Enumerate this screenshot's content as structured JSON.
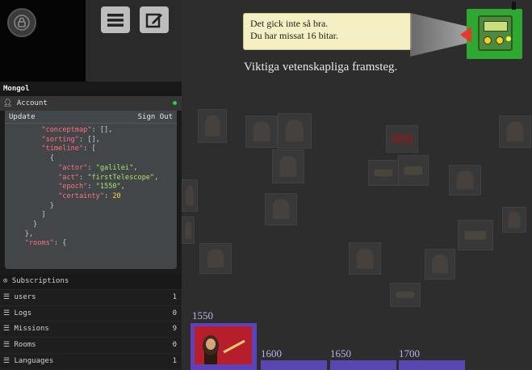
{
  "app": {
    "title": "Mongol"
  },
  "account": {
    "label": "Account",
    "status_color": "#2ecc40"
  },
  "json_box": {
    "update_label": "Update",
    "signout_label": "Sign Out",
    "lines": [
      "\"conceptmap\": [],",
      "\"sorting\": [],",
      "\"timeline\": [",
      "{",
      "\"actor\": \"galilei\",",
      "\"act\": \"firstTelescope\",",
      "\"epoch\": \"1550\",",
      "\"certainty\": 20",
      "}",
      "]",
      "}",
      "},",
      "\"rooms\": {"
    ]
  },
  "subscriptions": {
    "label": "Subscriptions",
    "items": [
      {
        "name": "users",
        "count": "1"
      },
      {
        "name": "Logs",
        "count": "0"
      },
      {
        "name": "Missions",
        "count": "9"
      },
      {
        "name": "Rooms",
        "count": "0"
      },
      {
        "name": "Languages",
        "count": "1"
      }
    ]
  },
  "notice": {
    "line1": "Det gick inte så bra.",
    "line2": "Du har missat 16 bitar."
  },
  "subtitle": "Viktiga vetenskapliga framsteg.",
  "timeline": {
    "start_label": "1550",
    "labels": [
      "1600",
      "1650",
      "1700"
    ]
  },
  "colors": {
    "background": "#2d2d2d",
    "timeline": "#5a46b0",
    "robot": "#2fa832",
    "notice_bg": "#f4f0c4"
  },
  "icons": {
    "lock": "lock-icon",
    "menu": "menu-icon",
    "edit": "edit-icon"
  }
}
